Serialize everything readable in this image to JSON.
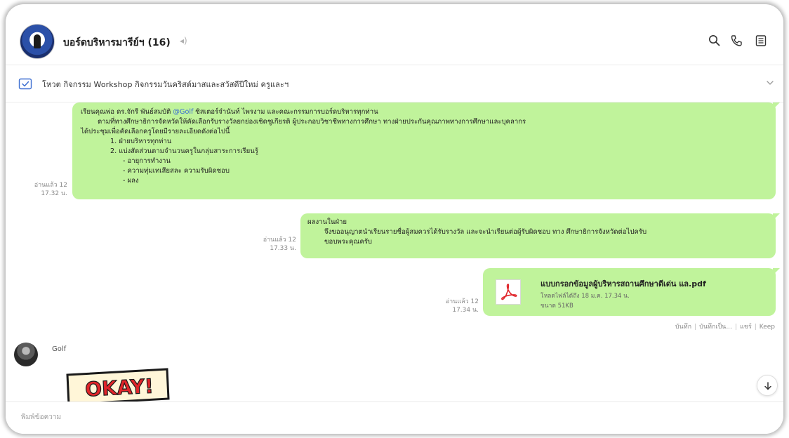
{
  "header": {
    "title": "บอร์ดบริหารมารีย์ฯ (16)",
    "mute_glyph": "◂)",
    "icons": [
      "search-icon",
      "phone-icon",
      "menu-icon"
    ]
  },
  "announcement": {
    "text": "โหวต กิจกรรม Workshop  กิจกรรมวันคริสต์มาสและสวัสดีปีใหม่ ครูและฯ"
  },
  "messages": [
    {
      "read": "อ่านแล้ว 12",
      "time": "17.32 น.",
      "line1_before": "เรียนคุณพ่อ ดร.จักรี พันธ์สมบัติ ",
      "mention": "@Golf",
      "line1_after": " ซิสเตอร์จำนันท์ ไพรงาม และคณะกรรมการบอร์ดบริหารทุกท่าน",
      "line2": "ตามที่ทางศึกษาธิการจัดหวัดให้คัดเลือกรับรางวัลยกย่องเชิดชูเกียรติ ผู้ประกอบวิชาชีพทางการศึกษา  ทางฝ่ายประกันคุณภาพทางการศึกษาและบุคลากร",
      "line3": "ได้ประชุมเพื่อคัดเลือกครูโดยมีรายละเอียดดังต่อไปนี้",
      "line4": "1. ฝ่ายบริหารทุกท่าน",
      "line5": "2. แบ่งสัดส่วนตามจำนวนครูในกลุ่มสาระการเรียนรู้",
      "line6": "- อายุการทำงาน",
      "line7": "- ความทุ่มเทเสียสละ ความรับผิดชอบ",
      "line8": "- ผลง"
    },
    {
      "read": "อ่านแล้ว 12",
      "time": "17.33 น.",
      "line1": "ผลงานในฝ่าย",
      "line2": "จึงขออนุญาตนำเรียนรายชื่อผู้สมควรได้รับรางวัล และจะนำเรียนต่อผู้รับผิดชอบ ทาง ศึกษาธิการจังหวัดต่อไปครับ",
      "line3": "ขอบพระคุณครับ"
    },
    {
      "read": "อ่านแล้ว 12",
      "time": "17.34 น.",
      "file_name": "แบบกรอกข้อมูลผู้บริหารสถานศึกษาดีเด่น แล.pdf",
      "file_expiry": "โหลดไฟล์ได้ถึง 18 ม.ค. 17.34 น.",
      "file_size": "ขนาด 51KB",
      "actions": [
        "บันทึก",
        "บันทึกเป็น...",
        "แชร์",
        "Keep"
      ]
    }
  ],
  "incoming": {
    "sender": "Golf",
    "sticker_text": "OKAY!"
  },
  "composer": {
    "placeholder": "พิมพ์ข้อความ"
  },
  "colors": {
    "bubble": "#c0f39b",
    "mention": "#3d6fd1",
    "pdf_red": "#e0252a"
  }
}
